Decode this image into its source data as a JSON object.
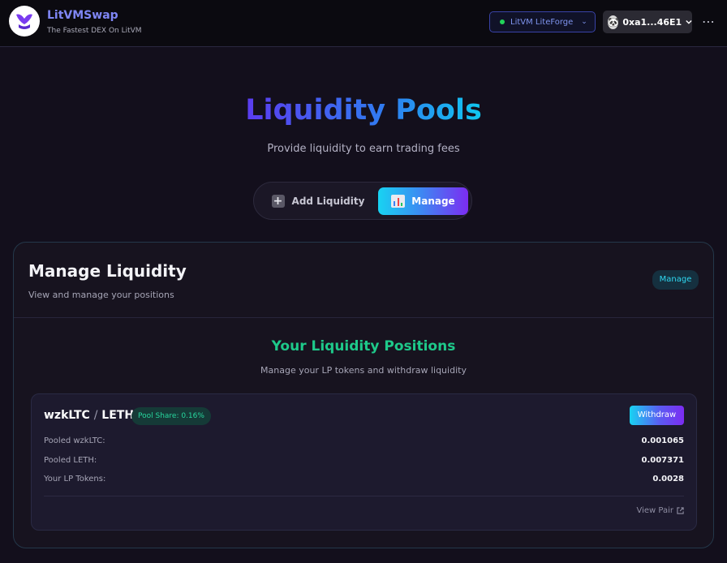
{
  "header": {
    "brand_name": "LitVMSwap",
    "brand_tagline": "The Fastest DEX On LitVM",
    "network": "LitVM LiteForge",
    "wallet": "0xa1...46E1",
    "network_status_color": "#22d35a"
  },
  "hero": {
    "title": "Liquidity Pools",
    "subtitle": "Provide liquidity to earn trading fees"
  },
  "tabs": [
    {
      "label": "Add Liquidity",
      "icon": "plus-icon",
      "active": false
    },
    {
      "label": "Manage",
      "icon": "chart-icon",
      "active": true
    }
  ],
  "card": {
    "title": "Manage Liquidity",
    "subtitle": "View and manage your positions",
    "badge": "Manage",
    "section_title": "Your Liquidity Positions",
    "section_subtitle": "Manage your LP tokens and withdraw liquidity"
  },
  "positions": [
    {
      "token_a": "wzkLTC",
      "separator": "/",
      "token_b": "LETH",
      "pool_share": "Pool Share: 0.16%",
      "withdraw_label": "Withdraw",
      "rows": [
        {
          "label": "Pooled wzkLTC:",
          "value": "0.001065"
        },
        {
          "label": "Pooled LETH:",
          "value": "0.007371"
        },
        {
          "label": "Your LP Tokens:",
          "value": "0.0028"
        }
      ],
      "view_pair_label": "View Pair"
    }
  ],
  "colors": {
    "accent_purple": "#7c2cf2",
    "accent_cyan": "#18d3f2",
    "accent_green": "#1ec98a"
  }
}
